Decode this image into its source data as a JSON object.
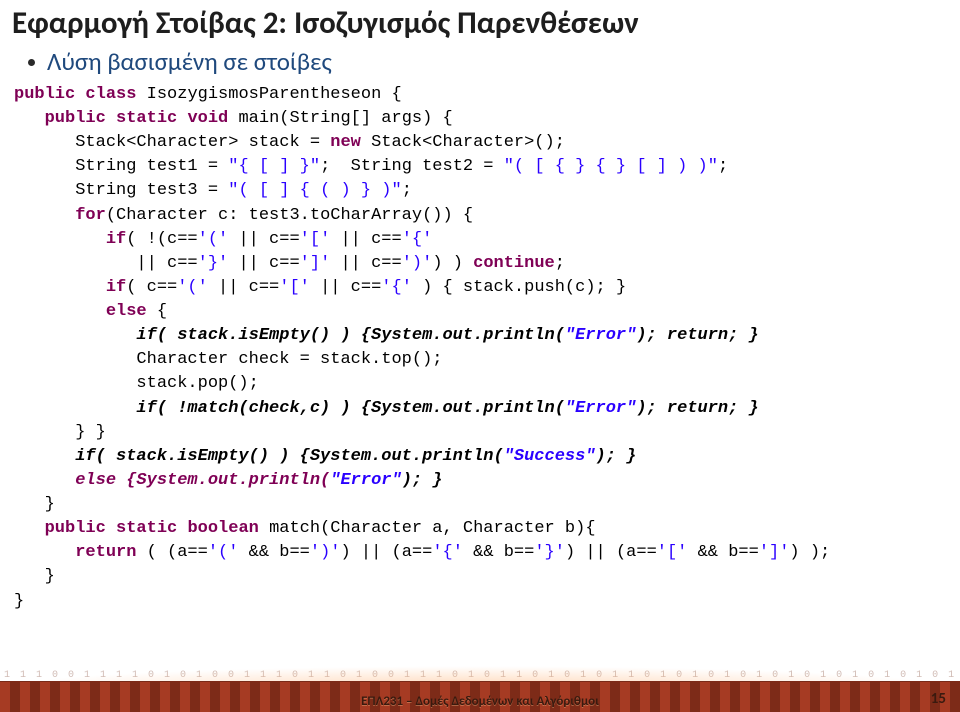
{
  "title": "Εφαρμογή Στοίβας 2: Ισοζυγισμός Παρενθέσεων",
  "bullet": "Λύση βασισμένη σε στοίβες",
  "code": {
    "l01a": "public",
    "l01b": " class",
    "l01c": " IsozygismosParentheseon {",
    "l02a": "   public",
    "l02b": " static",
    "l02c": " void",
    "l02d": " main(String[] args) {",
    "l03a": "      Stack<Character> stack = ",
    "l03b": "new",
    "l03c": " Stack<Character>();",
    "l04a": "      String test1 = ",
    "l04b": "\"{ [ ] }\"",
    "l04c": ";  String test2 = ",
    "l04d": "\"( [ { } { } [ ] ) )\"",
    "l04e": ";",
    "l05a": "      String test3 = ",
    "l05b": "\"( [ ] { ( ) } )\"",
    "l05c": ";",
    "l06a": "      for",
    "l06b": "(Character c: test3.toCharArray()) {",
    "l07a": "         if",
    "l07b": "( !(c==",
    "l07c": "'('",
    "l07d": " || c==",
    "l07e": "'['",
    "l07f": " || c==",
    "l07g": "'{'",
    "l08a": "            || c==",
    "l08b": "'}'",
    "l08c": " || c==",
    "l08d": "']'",
    "l08e": " || c==",
    "l08f": "')'",
    "l08g": ") ) ",
    "l08h": "continue",
    "l08i": ";",
    "l09a": "         if",
    "l09b": "( c==",
    "l09c": "'('",
    "l09d": " || c==",
    "l09e": "'['",
    "l09f": " || c==",
    "l09g": "'{'",
    "l09h": " ) { stack.push(c); }",
    "l10a": "         else",
    "l10b": " {",
    "l11a": "            if( stack.isEmpty() ) {System.out.println(",
    "l11b": "\"Error\"",
    "l11c": "); return; }",
    "l12": "            Character check = stack.top();",
    "l13": "            stack.pop();",
    "l14a": "            if( !match(check,c) ) {System.out.println(",
    "l14b": "\"Error\"",
    "l14c": "); return; }",
    "l15": "      } }",
    "l16a": "      if( stack.isEmpty() ) {System.out.println(",
    "l16b": "\"Success\"",
    "l16c": "); }",
    "l17a": "      else {System.out.println(",
    "l17b": "\"Error\"",
    "l17c": "); }",
    "l18": "   }",
    "l19a": "   public",
    "l19b": " static",
    "l19c": " boolean",
    "l19d": " match(Character a, Character b){",
    "l20a": "      return",
    "l20b": " ( (a==",
    "l20c": "'('",
    "l20d": " && b==",
    "l20e": "')'",
    "l20f": ") || (a==",
    "l20g": "'{'",
    "l20h": " && b==",
    "l20i": "'}'",
    "l20j": ") || (a==",
    "l20k": "'['",
    "l20l": " && b==",
    "l20m": "']'",
    "l20n": ") );",
    "l21": "   }",
    "l22": "}"
  },
  "footer": {
    "title": "ΕΠΛ231 – Δομές Δεδομένων και Αλγόριθμοι",
    "page": "15",
    "binary": "1 1 1 0 0 1 1 1 1 0 1 0 1 0 0 1 1 1 0 1 1 0 1 0 0 1 1 1 0 1 0 1 1 0 1 0 1 0 1 1 0 1 0 1 0 1 0 1 0 1 0 1 0 1 0 1 0 1 0 1 0 1"
  }
}
